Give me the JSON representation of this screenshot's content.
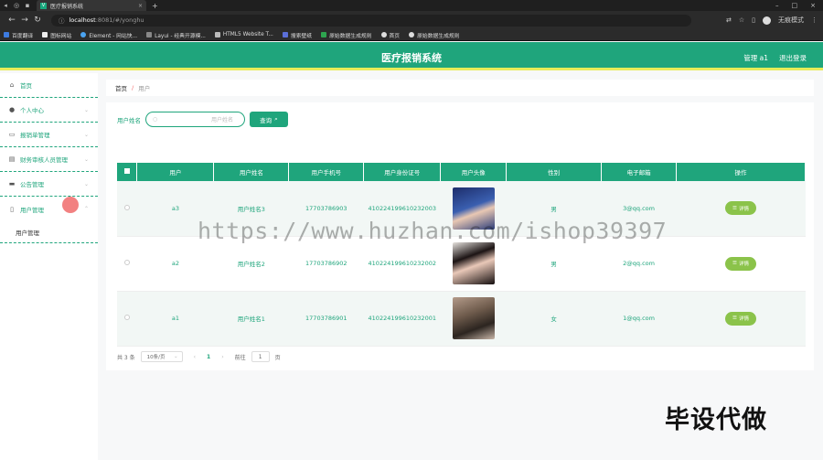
{
  "browser": {
    "tab_title": "医疗报销系统",
    "url_host": "localhost",
    "url_rest": ":8081/#/yonghu",
    "profile_label": "无痕模式",
    "bookmarks": [
      "百度翻译",
      "图标网站",
      "Element - 网站快...",
      "Layui - 经典开源模...",
      "HTML5 Website T...",
      "搜索壁纸",
      "原始数据生成规则",
      "首页",
      "原始数据生成规则"
    ]
  },
  "header": {
    "title": "医疗报销系统",
    "user_label": "管理 a1",
    "logout_label": "退出登录"
  },
  "sidebar": {
    "items": [
      {
        "label": "首页",
        "icon": "home-icon"
      },
      {
        "label": "个人中心",
        "icon": "user-icon"
      },
      {
        "label": "报销单管理",
        "icon": "chat-icon"
      },
      {
        "label": "财务审核人员管理",
        "icon": "doc-icon"
      },
      {
        "label": "公告管理",
        "icon": "list-icon"
      },
      {
        "label": "用户管理",
        "icon": "phone-icon"
      }
    ],
    "submenu_label": "用户管理"
  },
  "breadcrumb": {
    "home": "首页",
    "sep": "/",
    "current": "用户"
  },
  "search": {
    "label": "用户姓名",
    "placeholder": "用户姓名",
    "button_label": "查询"
  },
  "table": {
    "headers": [
      "用户",
      "用户姓名",
      "用户手机号",
      "用户身份证号",
      "用户头像",
      "性别",
      "电子邮箱",
      "操作"
    ],
    "rows": [
      {
        "user": "a3",
        "name": "用户姓名3",
        "phone": "17703786903",
        "id_no": "410224199610232003",
        "gender": "男",
        "email": "3@qq.com",
        "action": "详情"
      },
      {
        "user": "a2",
        "name": "用户姓名2",
        "phone": "17703786902",
        "id_no": "410224199610232002",
        "gender": "男",
        "email": "2@qq.com",
        "action": "详情"
      },
      {
        "user": "a1",
        "name": "用户姓名1",
        "phone": "17703786901",
        "id_no": "410224199610232001",
        "gender": "女",
        "email": "1@qq.com",
        "action": "详情"
      }
    ]
  },
  "pager": {
    "total": "共 3 条",
    "page_size": "10条/页",
    "current_page": "1",
    "goto_label": "前往",
    "goto_value": "1",
    "page_unit": "页"
  },
  "watermark": "https://www.huzhan.com/ishop39397",
  "corner_text": "毕设代做",
  "colors": {
    "primary": "#1fa57c",
    "header_border": "#e7ec59",
    "detail_button": "#8bc34a"
  }
}
